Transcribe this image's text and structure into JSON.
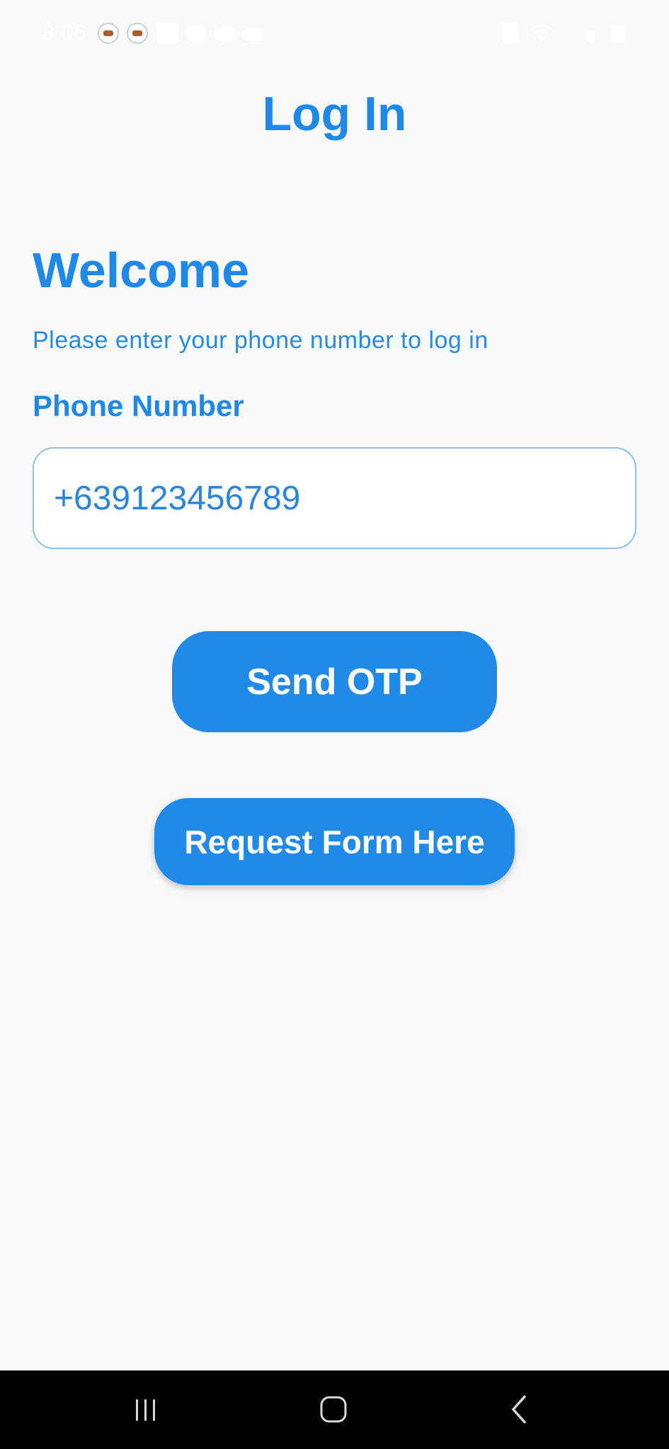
{
  "status_bar": {
    "time": "8:06",
    "icons": [
      "app-notification-icon",
      "app-notification-icon",
      "image-icon",
      "discord-icon",
      "cloud-icon",
      "cloud-icon",
      "battery-saver-icon",
      "wifi-icon",
      "signal-icon",
      "battery-icon"
    ]
  },
  "header": {
    "title": "Log In"
  },
  "login_form": {
    "heading": "Welcome",
    "instruction": "Please enter your phone number to log in",
    "phone_label": "Phone Number",
    "phone_value": "+639123456789",
    "send_otp_label": "Send OTP",
    "request_form_label": "Request Form Here"
  },
  "nav_bar": {
    "buttons": [
      "recent-apps-icon",
      "home-icon",
      "back-icon"
    ]
  },
  "colors": {
    "accent": "#2189e6",
    "background": "#f8f9fb",
    "input_border": "#8cc2ee"
  }
}
